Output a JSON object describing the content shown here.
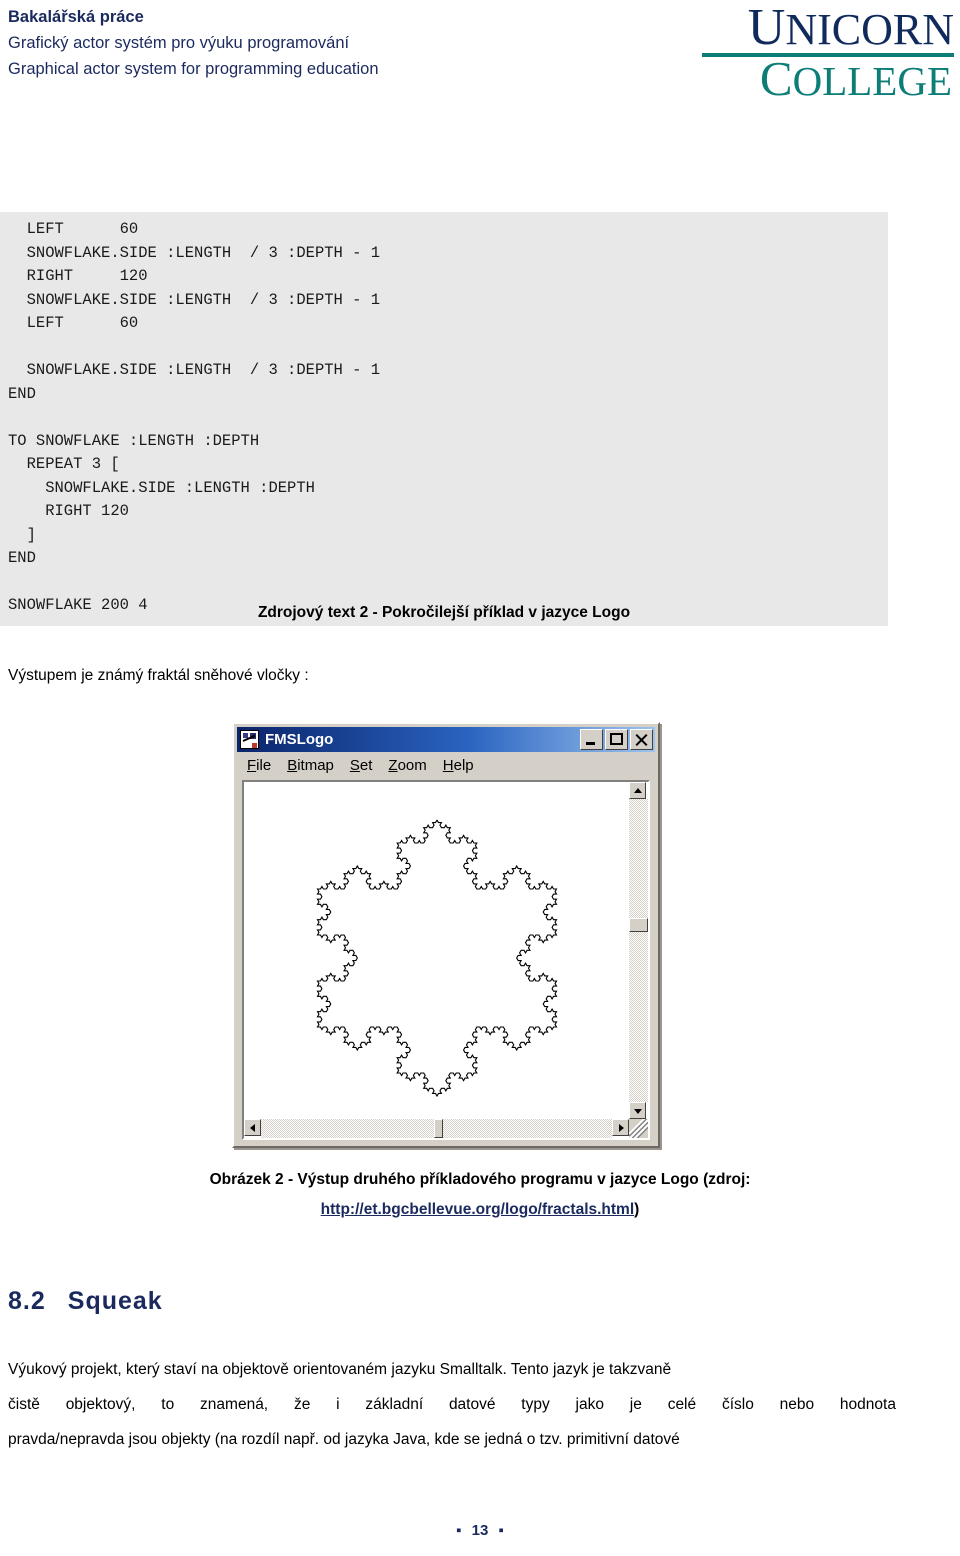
{
  "header": {
    "thesis_type": "Bakalářská práce",
    "title_cs": "Grafický actor systém pro výuku programování",
    "title_en": "Graphical actor system for programming education",
    "accent_navy": "#1b2a5e",
    "accent_teal": "#0d7d78"
  },
  "logo": {
    "word_top": "NICORN",
    "word_top_cap": "U",
    "word_bottom": "OLLEGE",
    "word_bottom_cap": "C"
  },
  "code_block": {
    "lines": [
      "  LEFT      60",
      "  SNOWFLAKE.SIDE :LENGTH  / 3 :DEPTH - 1",
      "  RIGHT     120",
      "  SNOWFLAKE.SIDE :LENGTH  / 3 :DEPTH - 1",
      "  LEFT      60",
      "",
      "  SNOWFLAKE.SIDE :LENGTH  / 3 :DEPTH - 1",
      "END",
      "",
      "TO SNOWFLAKE :LENGTH :DEPTH",
      "  REPEAT 3 [",
      "    SNOWFLAKE.SIDE :LENGTH :DEPTH",
      "    RIGHT 120",
      "  ]",
      "END",
      "",
      "SNOWFLAKE 200 4"
    ]
  },
  "source_caption": "Zdrojový text 2 - Pokročilejší příklad v jazyce Logo",
  "intro_line": "Výstupem je známý fraktál sněhové vločky :",
  "fmslogo": {
    "title": "FMSLogo",
    "menu": [
      {
        "accel": "F",
        "rest": "ile"
      },
      {
        "accel": "B",
        "rest": "itmap"
      },
      {
        "accel": "S",
        "rest": "et"
      },
      {
        "accel": "Z",
        "rest": "oom"
      },
      {
        "accel": "H",
        "rest": "elp"
      }
    ],
    "minimize_label": "_",
    "maximize_label": "□",
    "close_label": "×"
  },
  "figure_caption": {
    "line1": "Obrázek 2 - Výstup druhého příkladového programu v jazyce Logo (zdroj:",
    "url": "http://et.bgcbellevue.org/logo/fractals.html",
    "closing": ")"
  },
  "section": {
    "number": "8.2",
    "title": "Squeak"
  },
  "paragraph": {
    "line1": "Výukový projekt, který staví na objektově orientovaném jazyku Smalltalk. Tento jazyk je takzvaně",
    "line2_words": [
      "čistě",
      "objektový,",
      "to",
      "znamená,",
      "že",
      "i",
      "základní",
      "datové",
      "typy",
      "jako",
      "je",
      "celé",
      "číslo",
      "nebo",
      "hodnota"
    ],
    "line3": "pravda/nepravda jsou objekty (na rozdíl např. od jazyka Java, kde se jedná o tzv. primitivní datové"
  },
  "footer": {
    "page_number": "13",
    "bullet_left": "▪",
    "bullet_right": "▪"
  }
}
